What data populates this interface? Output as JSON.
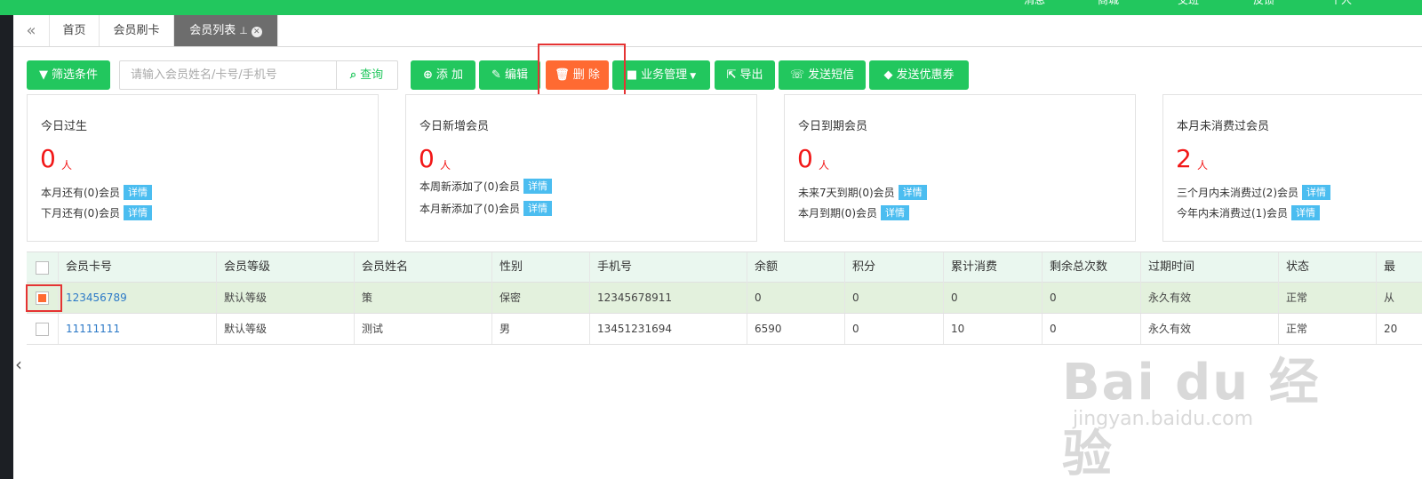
{
  "topbar": {
    "items": [
      "消息",
      "商城",
      "交班",
      "反馈",
      "个人"
    ]
  },
  "tabs": {
    "collapse_icon": "«",
    "items": [
      {
        "label": "首页"
      },
      {
        "label": "会员刷卡"
      },
      {
        "label": "会员列表",
        "active": true
      }
    ],
    "pin_icon": "pin-icon",
    "close_icon": "close-icon"
  },
  "toolbar": {
    "filter_label": "筛选条件",
    "search_placeholder": "请输入会员姓名/卡号/手机号",
    "search_value": "",
    "query_label": "查询",
    "add_label": "添 加",
    "edit_label": "编辑",
    "delete_label": "删 除",
    "business_label": "业务管理",
    "export_label": "导出",
    "sms_label": "发送短信",
    "coupon_label": "发送优惠券"
  },
  "cards": [
    {
      "title": "今日过生",
      "count": "0",
      "unit": "人",
      "lines": [
        {
          "text": "本月还有(0)会员",
          "badge": "详情"
        },
        {
          "text": "下月还有(0)会员",
          "badge": "详情"
        }
      ]
    },
    {
      "title": "今日新增会员",
      "count": "0",
      "unit": "人",
      "lines": [
        {
          "text": "本周新添加了(0)会员",
          "badge": "详情"
        },
        {
          "text": "本月新添加了(0)会员",
          "badge": "详情"
        }
      ]
    },
    {
      "title": "今日到期会员",
      "count": "0",
      "unit": "人",
      "lines": [
        {
          "text": "未来7天到期(0)会员",
          "badge": "详情"
        },
        {
          "text": "本月到期(0)会员",
          "badge": "详情"
        }
      ]
    },
    {
      "title": "本月未消费过会员",
      "count": "2",
      "unit": "人",
      "lines": [
        {
          "text": "三个月内未消费过(2)会员",
          "badge": "详情"
        },
        {
          "text": "今年内未消费过(1)会员",
          "badge": "详情"
        }
      ]
    }
  ],
  "table": {
    "headers": [
      "会员卡号",
      "会员等级",
      "会员姓名",
      "性别",
      "手机号",
      "余额",
      "积分",
      "累计消费",
      "剩余总次数",
      "过期时间",
      "状态",
      "最"
    ],
    "rows": [
      {
        "checked": true,
        "cells": [
          "123456789",
          "默认等级",
          "策",
          "保密",
          "12345678911",
          "0",
          "0",
          "0",
          "0",
          "永久有效",
          "正常",
          "从"
        ]
      },
      {
        "checked": false,
        "cells": [
          "11111111",
          "默认等级",
          "测试",
          "男",
          "13451231694",
          "6590",
          "0",
          "10",
          "0",
          "永久有效",
          "正常",
          "20"
        ]
      }
    ]
  },
  "watermark": {
    "line1": "Bai du 经验",
    "line2": "jingyan.baidu.com"
  },
  "colors": {
    "primary": "#22c75e",
    "danger": "#ff6a32",
    "accent_red": "#f21818",
    "badge": "#4bbdf0",
    "highlight": "#e53333"
  }
}
